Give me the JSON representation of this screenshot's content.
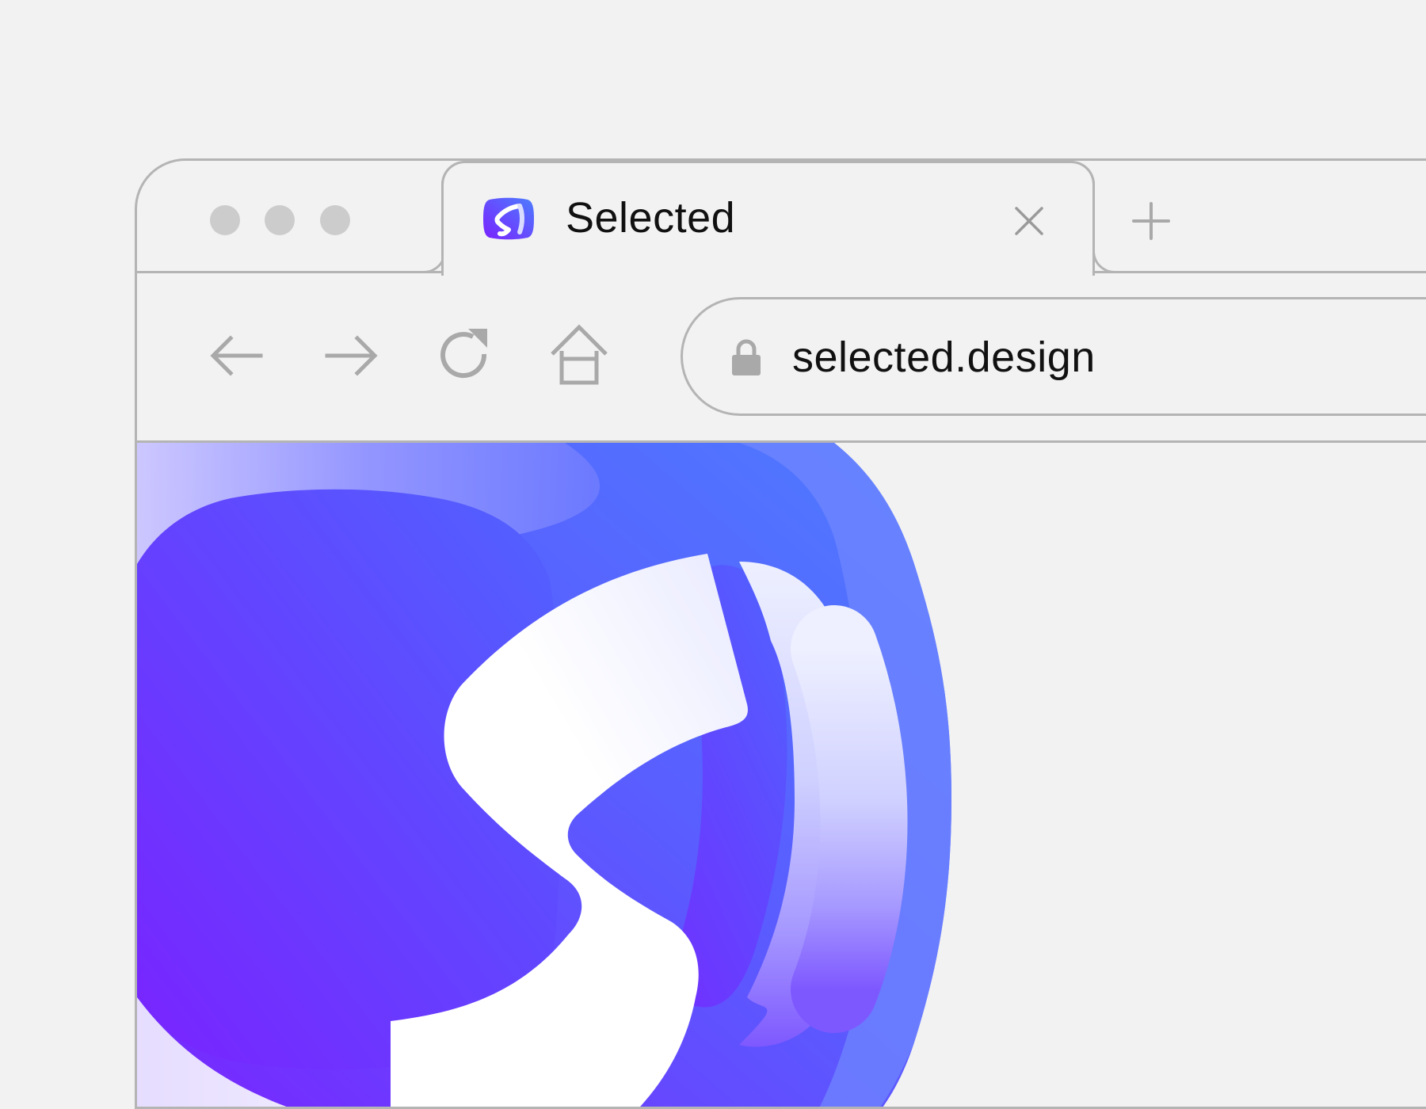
{
  "browser": {
    "window_controls": [
      "close-dot",
      "minimize-dot",
      "maximize-dot"
    ],
    "tabs": [
      {
        "title": "Selected",
        "favicon": "selected-logo-icon",
        "active": true
      }
    ],
    "close_tab_icon": "close-icon",
    "new_tab_icon": "plus-icon",
    "toolbar": {
      "back_icon": "arrow-left-icon",
      "forward_icon": "arrow-right-icon",
      "reload_icon": "reload-icon",
      "home_icon": "home-icon"
    },
    "address_bar": {
      "secure_icon": "lock-icon",
      "url": "selected.design"
    }
  },
  "page": {
    "hero_logo": "selected-logo",
    "colors": {
      "brand_violet": "#7a22ff",
      "brand_blue": "#4d7dff",
      "ui_gray": "#b4b4b4"
    }
  }
}
